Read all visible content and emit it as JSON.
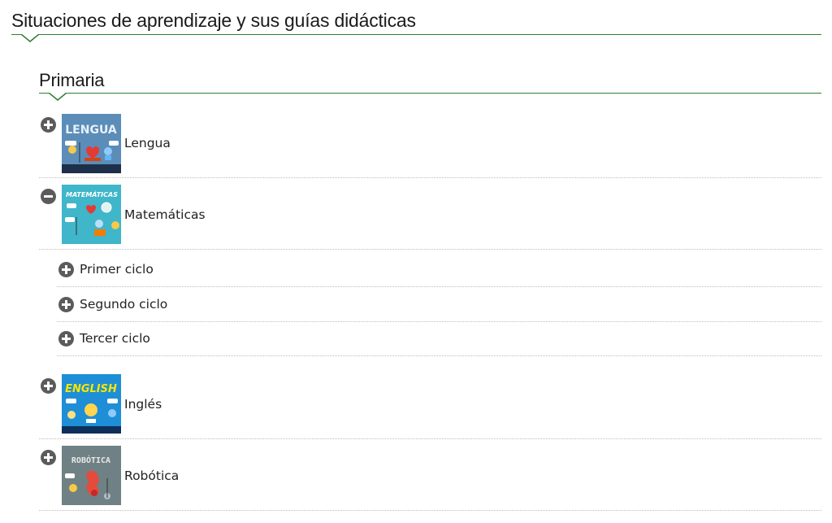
{
  "page": {
    "title": "Situaciones de aprendizaje y sus guías didácticas",
    "section_title": "Primaria"
  },
  "subjects": [
    {
      "label": "Lengua",
      "thumb_text": "LENGUA",
      "expanded": false,
      "icon": "plus-icon"
    },
    {
      "label": "Matemáticas",
      "thumb_text": "MATEMÁTICAS",
      "expanded": true,
      "icon": "minus-icon"
    },
    {
      "label": "Inglés",
      "thumb_text": "ENGLISH",
      "expanded": false,
      "icon": "plus-icon"
    },
    {
      "label": "Robótica",
      "thumb_text": "ROBÓTICA",
      "expanded": false,
      "icon": "plus-icon"
    }
  ],
  "matematicas_cycles": [
    {
      "label": "Primer ciclo",
      "icon": "plus-icon"
    },
    {
      "label": "Segundo ciclo",
      "icon": "plus-icon"
    },
    {
      "label": "Tercer ciclo",
      "icon": "plus-icon"
    }
  ],
  "colors": {
    "accent_rule": "#2e7d32",
    "toggle": "#5b5b5b",
    "divider": "#bdbdbd"
  }
}
